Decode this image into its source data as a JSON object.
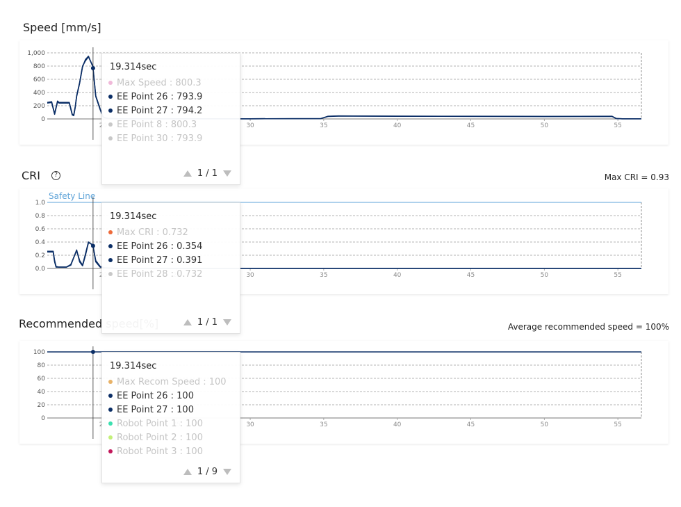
{
  "colors": {
    "line": "#0b2e66",
    "grid": "#9a9a9a",
    "safety": "#5ea3d8",
    "tick": "#8a8a8a"
  },
  "speed": {
    "title": "Speed [mm/s]",
    "tooltip": {
      "time": "19.314sec",
      "items": [
        {
          "label": "Max Speed : 800.3",
          "color": "#f0b9d9",
          "active": false
        },
        {
          "label": "EE Point 26 : 793.9",
          "color": "#0b2e66",
          "active": true
        },
        {
          "label": "EE Point 27 : 794.2",
          "color": "#0b2e66",
          "active": true
        },
        {
          "label": "EE Point 8 : 800.3",
          "color": "#c8c8c8",
          "active": false
        },
        {
          "label": "EE Point 30 : 793.9",
          "color": "#c8c8c8",
          "active": false
        }
      ],
      "page": "1 / 1"
    }
  },
  "cri": {
    "title": "CRI",
    "help_icon": "question-circle-icon",
    "help_symbol": "?",
    "max_note": "Max CRI = 0.93",
    "safety_label": "Safety Line",
    "tooltip": {
      "time": "19.314sec",
      "items": [
        {
          "label": "Max CRI : 0.732",
          "color": "#ee6a3a",
          "active": false
        },
        {
          "label": "EE Point 26 : 0.354",
          "color": "#0b2e66",
          "active": true
        },
        {
          "label": "EE Point 27 : 0.391",
          "color": "#0b2e66",
          "active": true
        },
        {
          "label": "EE Point 28 : 0.732",
          "color": "#c8c8c8",
          "active": false
        }
      ],
      "page": "1 / 1"
    }
  },
  "recommended": {
    "title": "Recommended speed[%]",
    "avg_note": "Average recommended speed = 100%",
    "tooltip": {
      "time": "19.314sec",
      "items": [
        {
          "label": "Max Recom Speed : 100",
          "color": "#e8b267",
          "active": false
        },
        {
          "label": "EE Point 26 : 100",
          "color": "#0b2e66",
          "active": true
        },
        {
          "label": "EE Point 27 : 100",
          "color": "#0b2e66",
          "active": true
        },
        {
          "label": "Robot Point 1 : 100",
          "color": "#3de0b0",
          "active": false
        },
        {
          "label": "Robot Point 2 : 100",
          "color": "#c4f07a",
          "active": false
        },
        {
          "label": "Robot Point 3 : 100",
          "color": "#c2185b",
          "active": false
        }
      ],
      "page": "1 / 9"
    }
  },
  "chart_data": [
    {
      "type": "line",
      "title": "Speed [mm/s]",
      "xlim": [
        16.2,
        56.6
      ],
      "ylim": [
        0,
        1000
      ],
      "yticks": [
        "0",
        "200",
        "400",
        "600",
        "800",
        "1,000"
      ],
      "xticks": [
        "20",
        "25",
        "30",
        "35",
        "40",
        "45",
        "50",
        "55"
      ],
      "grid": true,
      "cursor_x": 19.314,
      "series": [
        {
          "x": [
            16.2,
            16.5,
            16.7,
            16.9,
            17.0,
            17.1,
            17.4,
            17.7,
            17.9,
            18.0,
            18.1,
            18.2,
            18.4,
            18.6,
            18.8,
            19.0,
            19.3,
            19.5,
            19.8,
            20.0,
            20.3,
            21.0,
            26.0,
            30.0,
            34.8,
            35.3,
            36.0,
            40.0,
            45.0,
            50.0,
            54.6,
            54.9,
            55.3,
            56.6
          ],
          "y": [
            250,
            260,
            80,
            270,
            250,
            250,
            250,
            250,
            70,
            60,
            180,
            350,
            550,
            800,
            880,
            940,
            800,
            350,
            150,
            30,
            8,
            2,
            2,
            2,
            5,
            40,
            45,
            42,
            40,
            38,
            40,
            5,
            2,
            2
          ]
        },
        {
          "x": [
            16.2,
            16.5,
            16.7,
            16.9,
            17.0,
            17.1,
            17.4,
            17.7,
            17.9,
            18.0,
            18.1,
            18.2,
            18.4,
            18.6,
            18.8,
            19.0,
            19.3,
            19.5,
            19.8,
            20.0,
            20.3,
            21.0,
            26.0,
            30.0,
            34.8,
            35.3,
            36.0,
            40.0,
            45.0,
            50.0,
            54.6,
            54.9,
            55.3,
            56.6
          ],
          "y": [
            240,
            250,
            70,
            260,
            240,
            240,
            240,
            240,
            60,
            50,
            170,
            340,
            540,
            790,
            900,
            950,
            790,
            340,
            140,
            25,
            6,
            2,
            2,
            2,
            5,
            38,
            43,
            40,
            39,
            37,
            38,
            5,
            2,
            2
          ]
        }
      ]
    },
    {
      "type": "line",
      "title": "CRI",
      "xlim": [
        16.2,
        56.6
      ],
      "ylim": [
        0,
        1.0
      ],
      "yticks": [
        "0.0",
        "0.2",
        "0.4",
        "0.6",
        "0.8",
        "1.0"
      ],
      "xticks": [
        "20",
        "25",
        "30",
        "35",
        "40",
        "45",
        "50",
        "55"
      ],
      "grid": true,
      "safety_line": 1.0,
      "cursor_x": 19.314,
      "series": [
        {
          "x": [
            16.2,
            16.6,
            16.7,
            16.8,
            17.0,
            17.5,
            17.8,
            18.2,
            18.4,
            18.6,
            18.8,
            19.0,
            19.3,
            19.5,
            19.8,
            20.1,
            21.0,
            30.0,
            56.6
          ],
          "y": [
            0.25,
            0.25,
            0.1,
            0.02,
            0.02,
            0.02,
            0.05,
            0.28,
            0.1,
            0.04,
            0.2,
            0.39,
            0.36,
            0.1,
            0.02,
            0.01,
            0.0,
            0.0,
            0.0
          ]
        },
        {
          "x": [
            16.2,
            16.6,
            16.7,
            16.8,
            17.0,
            17.5,
            17.8,
            18.2,
            18.4,
            18.6,
            18.8,
            19.0,
            19.3,
            19.5,
            19.8,
            20.1,
            21.0,
            30.0,
            56.6
          ],
          "y": [
            0.26,
            0.26,
            0.12,
            0.03,
            0.02,
            0.02,
            0.06,
            0.27,
            0.12,
            0.05,
            0.22,
            0.4,
            0.35,
            0.12,
            0.03,
            0.01,
            0.0,
            0.0,
            0.0
          ]
        }
      ]
    },
    {
      "type": "line",
      "title": "Recommended speed[%]",
      "xlim": [
        16.2,
        56.6
      ],
      "ylim": [
        0,
        100
      ],
      "yticks": [
        "0",
        "20",
        "40",
        "60",
        "80",
        "100"
      ],
      "xticks": [
        "20",
        "25",
        "30",
        "35",
        "40",
        "45",
        "50",
        "55"
      ],
      "grid": true,
      "cursor_x": 19.314,
      "series": [
        {
          "x": [
            16.2,
            56.6
          ],
          "y": [
            100,
            100
          ]
        }
      ]
    }
  ]
}
